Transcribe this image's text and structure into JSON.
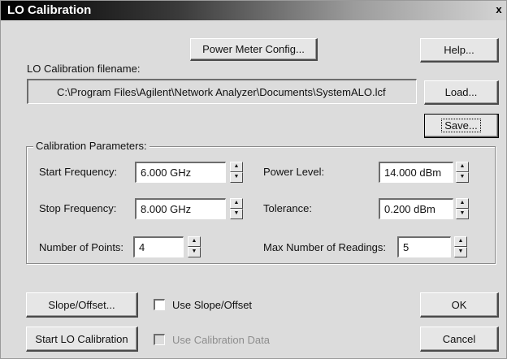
{
  "window": {
    "title": "LO Calibration",
    "close_glyph": "x"
  },
  "buttons": {
    "power_meter_config": "Power Meter Config...",
    "help": "Help...",
    "load": "Load...",
    "save": "Save...",
    "slope_offset": "Slope/Offset...",
    "ok": "OK",
    "start_lo_calibration": "Start LO Calibration",
    "cancel": "Cancel"
  },
  "filename": {
    "label": "LO Calibration filename:",
    "value": "C:\\Program Files\\Agilent\\Network Analyzer\\Documents\\SystemALO.lcf"
  },
  "calibration_parameters": {
    "title": "Calibration Parameters:",
    "start_frequency": {
      "label": "Start Frequency:",
      "value": "6.000 GHz"
    },
    "stop_frequency": {
      "label": "Stop Frequency:",
      "value": "8.000 GHz"
    },
    "number_of_points": {
      "label": "Number of Points:",
      "value": "4"
    },
    "power_level": {
      "label": "Power Level:",
      "value": "14.000 dBm"
    },
    "tolerance": {
      "label": "Tolerance:",
      "value": "0.200 dBm"
    },
    "max_readings": {
      "label": "Max Number of Readings:",
      "value": "5"
    }
  },
  "options": {
    "use_slope_offset": {
      "label": "Use Slope/Offset",
      "checked": false,
      "enabled": true
    },
    "use_calibration_data": {
      "label": "Use Calibration Data",
      "checked": false,
      "enabled": false
    }
  },
  "icons": {
    "spin_up": "▲",
    "spin_down": "▼"
  }
}
